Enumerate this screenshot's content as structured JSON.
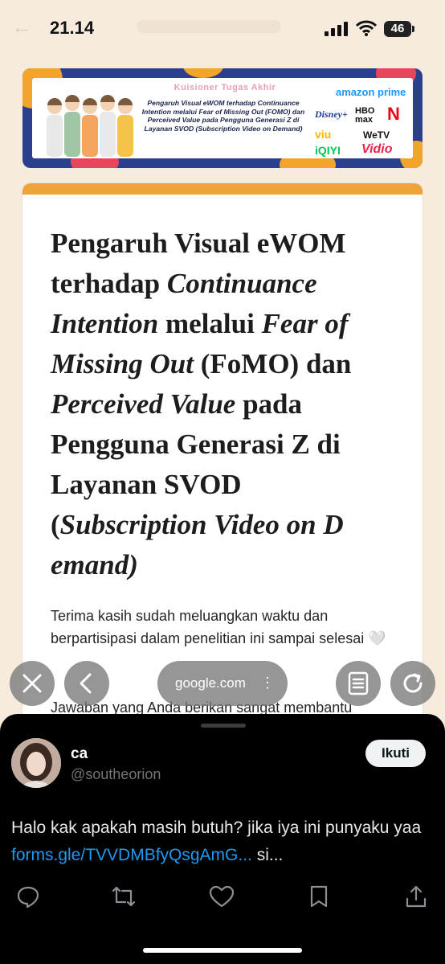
{
  "status_bar": {
    "time": "21.14",
    "battery": "46"
  },
  "banner": {
    "heading": "Kuisioner Tugas Akhir",
    "text": "Pengaruh Visual eWOM terhadap Continuance Intention melalui Fear of Missing Out (FOMO) dan Perceived Value pada Pengguna Generasi Z di Layanan SVOD (Subscription Video on Demand)",
    "logos": [
      "amazon prime",
      "Disney+",
      "HBO max",
      "N",
      "viu",
      "WeTV",
      "iQIYI",
      "Vidio"
    ]
  },
  "form": {
    "title_parts": [
      {
        "text": "Pengaruh Visual eWOM terhadap ",
        "italic": false
      },
      {
        "text": "Continuance Intention",
        "italic": true
      },
      {
        "text": " melalui ",
        "italic": false
      },
      {
        "text": "Fear of Missing Out",
        "italic": true
      },
      {
        "text": " (FoMO) dan ",
        "italic": false
      },
      {
        "text": "Perceived Value",
        "italic": true
      },
      {
        "text": " pada Pengguna Generasi Z di Layanan SVOD (",
        "italic": false
      },
      {
        "text": "Subscription Video on D emand)",
        "italic": true
      }
    ],
    "description_1": "Terima kasih sudah meluangkan waktu dan berpartisipasi dalam penelitian ini sampai selesai 🤍",
    "description_2": "Jawaban yang Anda berikan sangat membantu"
  },
  "browser_controls": {
    "url": "google.com",
    "menu": "⋮"
  },
  "tweet": {
    "display_name": "ca",
    "handle": "@southeorion",
    "follow_label": "Ikuti",
    "text_before_link": "Halo kak apakah masih butuh? jika iya ini punyaku yaa ",
    "link": "forms.gle/TVVDMBfyQsgAmG...",
    "text_after_link": " si..."
  },
  "colors": {
    "accent": "#eea43b",
    "link": "#1d9bf0",
    "sheet_bg": "#000000",
    "page_bg": "#f6ebdc"
  }
}
